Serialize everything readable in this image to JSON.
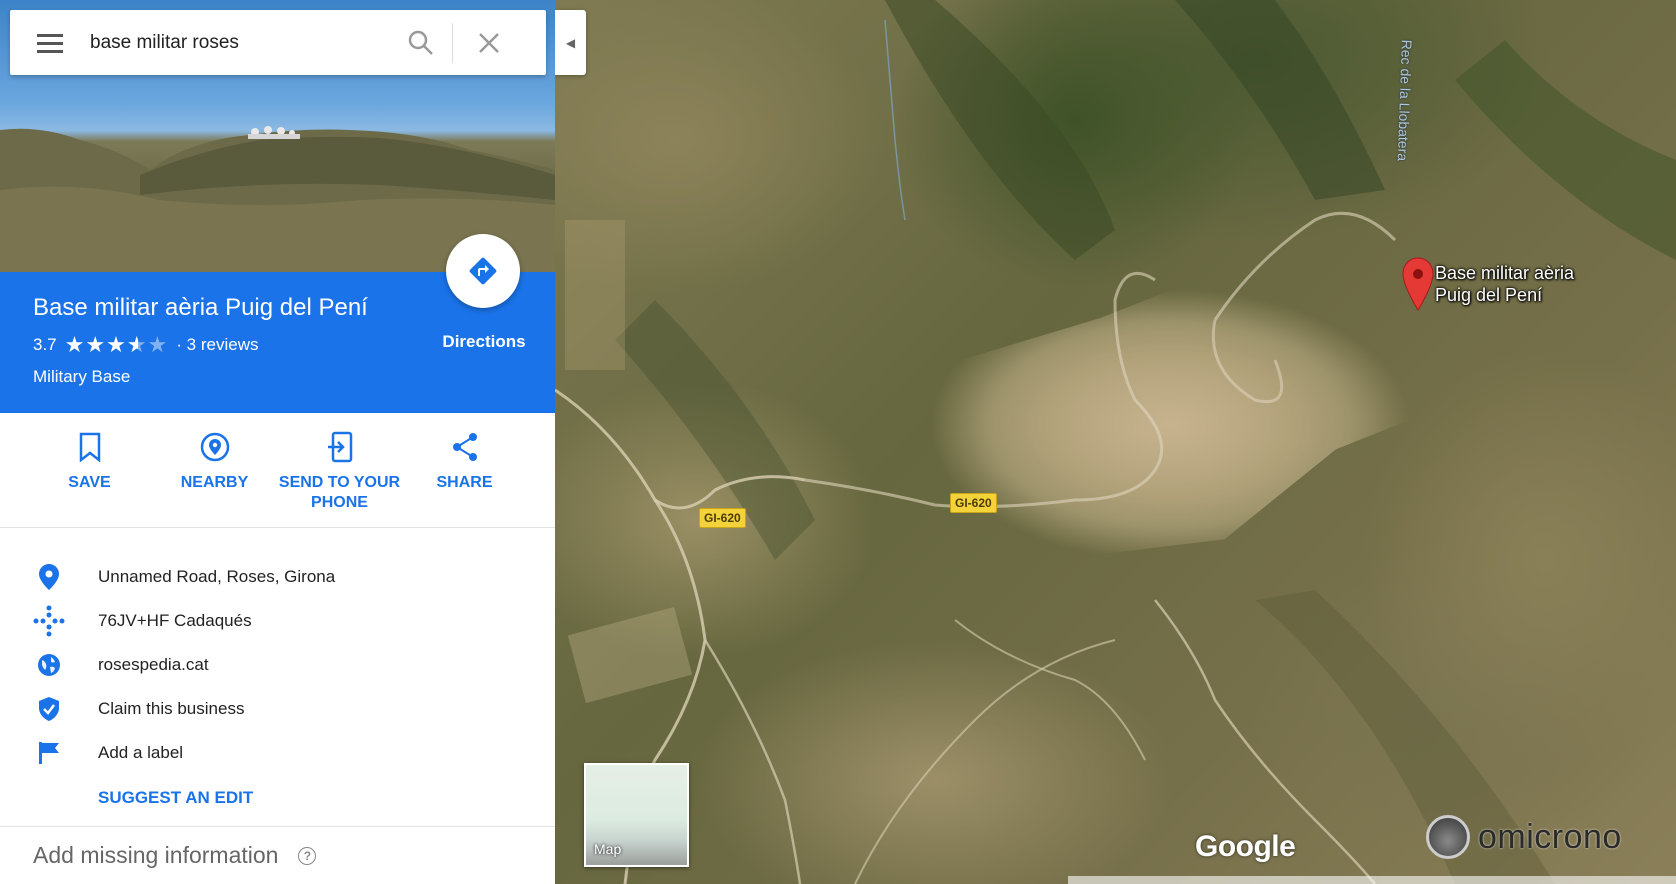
{
  "search": {
    "query": "base militar roses"
  },
  "place": {
    "name": "Base militar aèria Puig del Pení",
    "rating": "3.7",
    "stars": 3.7,
    "reviews": "· 3 reviews",
    "category": "Military Base",
    "directions_label": "Directions"
  },
  "actions": {
    "save": "SAVE",
    "nearby": "NEARBY",
    "send_line1": "SEND TO YOUR",
    "send_line2": "PHONE",
    "share": "SHARE"
  },
  "info": {
    "address": "Unnamed Road, Roses, Girona",
    "plus_code": "76JV+HF Cadaqués",
    "website": "rosespedia.cat",
    "claim": "Claim this business",
    "label": "Add a label",
    "suggest_edit": "SUGGEST AN EDIT",
    "add_missing": "Add missing information"
  },
  "map": {
    "pin_label_line1": "Base militar aèria",
    "pin_label_line2": "Puig del Pení",
    "creek_label": "Rec de la Llobatera",
    "road_label_1": "GI-620",
    "road_label_2": "GI-620",
    "minimap_label": "Map",
    "google_logo": "Google",
    "watermark": "omicrono"
  },
  "colors": {
    "accent": "#1a73e8",
    "pin": "#e53935"
  },
  "icons": {
    "menu": "hamburger-menu-icon",
    "search": "search-icon",
    "clear": "close-icon",
    "directions": "directions-icon",
    "save": "bookmark-icon",
    "nearby": "nearby-pin-icon",
    "send": "send-to-phone-icon",
    "share": "share-icon",
    "address": "location-pin-icon",
    "plus_code": "plus-code-icon",
    "website": "globe-icon",
    "claim": "verified-shield-icon",
    "label": "flag-icon",
    "help": "help-icon",
    "collapse": "collapse-arrow-icon"
  }
}
